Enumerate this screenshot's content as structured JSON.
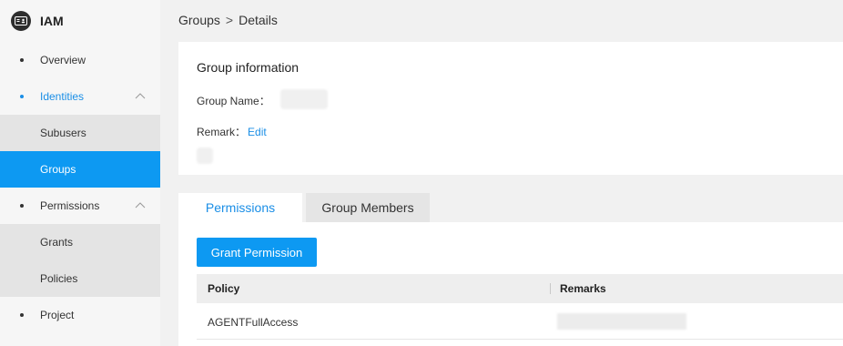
{
  "sidebar": {
    "app_name": "IAM",
    "items": [
      {
        "label": "Overview"
      },
      {
        "label": "Identities"
      },
      {
        "label": "Subusers"
      },
      {
        "label": "Groups"
      },
      {
        "label": "Permissions"
      },
      {
        "label": "Grants"
      },
      {
        "label": "Policies"
      },
      {
        "label": "Project"
      }
    ]
  },
  "breadcrumb": {
    "parent": "Groups",
    "separator": ">",
    "current": "Details"
  },
  "group_info": {
    "title": "Group information",
    "name_label": "Group Name：",
    "remark_label": "Remark：",
    "edit_label": "Edit"
  },
  "tabs": [
    {
      "label": "Permissions"
    },
    {
      "label": "Group Members"
    }
  ],
  "permissions": {
    "grant_button": "Grant Permission",
    "columns": [
      "Policy",
      "Remarks"
    ],
    "rows": [
      {
        "policy": "AGENTFullAccess"
      }
    ]
  },
  "colors": {
    "accent": "#0d99f2",
    "link": "#1a8ee6"
  }
}
